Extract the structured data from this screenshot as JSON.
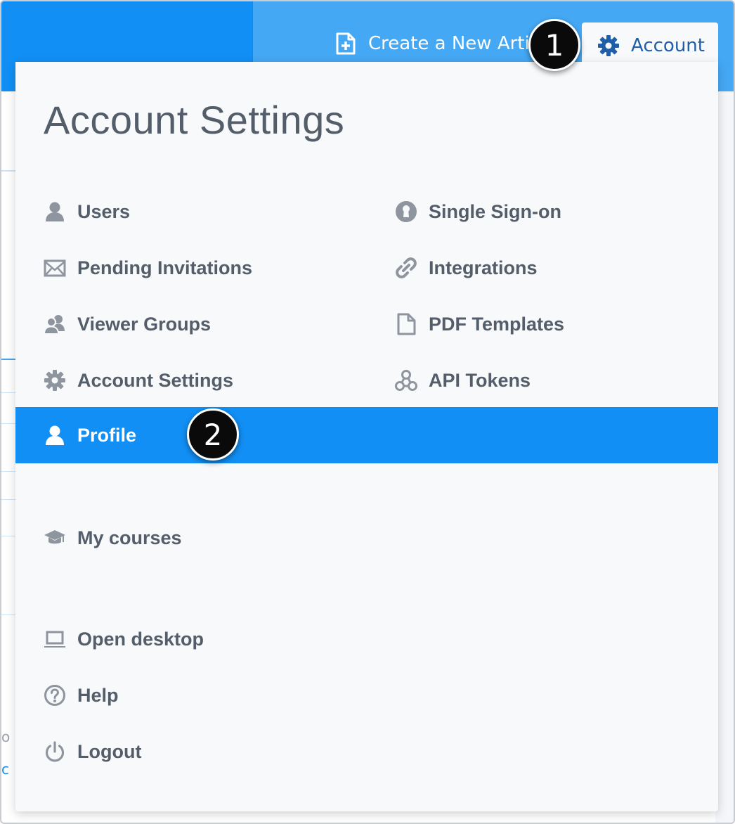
{
  "topbar": {
    "create_label": "Create a New Article",
    "account_label": "Account"
  },
  "panel": {
    "title": "Account Settings",
    "left_items": [
      {
        "label": "Users",
        "icon": "user-icon"
      },
      {
        "label": "Pending Invitations",
        "icon": "envelope-icon"
      },
      {
        "label": "Viewer Groups",
        "icon": "users-icon"
      },
      {
        "label": "Account Settings",
        "icon": "gear-icon"
      }
    ],
    "right_items": [
      {
        "label": "Single Sign-on",
        "icon": "keyhole-icon"
      },
      {
        "label": "Integrations",
        "icon": "link-icon"
      },
      {
        "label": "PDF Templates",
        "icon": "document-icon"
      },
      {
        "label": "API Tokens",
        "icon": "api-nodes-icon"
      }
    ],
    "profile": {
      "label": "Profile",
      "icon": "user-icon",
      "selected": true
    },
    "courses": {
      "label": "My courses",
      "icon": "graduation-cap-icon"
    },
    "bottom_items": [
      {
        "label": "Open desktop",
        "icon": "laptop-icon"
      },
      {
        "label": "Help",
        "icon": "question-circle-icon"
      },
      {
        "label": "Logout",
        "icon": "power-icon"
      }
    ]
  },
  "callouts": [
    "1",
    "2"
  ],
  "background": {
    "stub_text": "o",
    "stub_link": "c"
  },
  "colors": {
    "topbar_blue": "#45a8f4",
    "brand_blue": "#118ff5",
    "account_text": "#1f5fa9",
    "menu_text": "#545d6a",
    "icon_gray": "#8e959f",
    "panel_bg": "#f8f9fb"
  }
}
